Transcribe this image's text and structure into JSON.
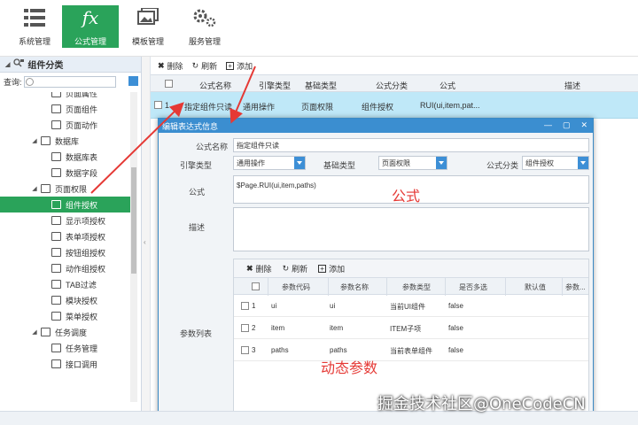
{
  "topbar": {
    "buttons": [
      {
        "label": "系统管理",
        "icon": "list-icon"
      },
      {
        "label": "公式管理",
        "icon": "fx-icon",
        "active": true
      },
      {
        "label": "模板管理",
        "icon": "images-icon"
      },
      {
        "label": "服务管理",
        "icon": "gears-icon"
      }
    ]
  },
  "left": {
    "header": "组件分类",
    "search_label": "查询:",
    "tree": [
      {
        "label": "页面属性",
        "level": 2
      },
      {
        "label": "页面组件",
        "level": 2
      },
      {
        "label": "页面动作",
        "level": 2
      },
      {
        "label": "数据库",
        "level": 1,
        "toggle": "◢"
      },
      {
        "label": "数据库表",
        "level": 2
      },
      {
        "label": "数据字段",
        "level": 2
      },
      {
        "label": "页面权限",
        "level": 1,
        "toggle": "◢"
      },
      {
        "label": "组件授权",
        "level": 2,
        "selected": true
      },
      {
        "label": "显示项授权",
        "level": 2
      },
      {
        "label": "表单项授权",
        "level": 2
      },
      {
        "label": "按钮组授权",
        "level": 2
      },
      {
        "label": "动作组授权",
        "level": 2
      },
      {
        "label": "TAB过滤",
        "level": 2
      },
      {
        "label": "模块授权",
        "level": 2
      },
      {
        "label": "菜单授权",
        "level": 2
      },
      {
        "label": "任务调度",
        "level": 1,
        "toggle": "◢"
      },
      {
        "label": "任务管理",
        "level": 2
      },
      {
        "label": "接口调用",
        "level": 2
      }
    ]
  },
  "main": {
    "toolbar": {
      "delete": "删除",
      "refresh": "刷新",
      "add": "添加"
    },
    "columns": [
      "公式名称",
      "引擎类型",
      "基础类型",
      "公式分类",
      "公式",
      "描述"
    ],
    "row": {
      "num": "1",
      "name": "指定组件只读",
      "engine": "通用操作",
      "base": "页面权限",
      "category": "组件授权",
      "formula": "RUI(ui,item,pat..."
    }
  },
  "dialog": {
    "title": "编辑表达式信息",
    "name_label": "公式名称",
    "name_value": "指定组件只读",
    "engine_label": "引擎类型",
    "engine_value": "通用操作",
    "base_label": "基础类型",
    "base_value": "页面权限",
    "category_label": "公式分类",
    "category_value": "组件授权",
    "formula_label": "公式",
    "formula_value": "$Page.RUI(ui,item,paths)",
    "desc_label": "描述",
    "params_label": "参数列表",
    "toolbar": {
      "delete": "删除",
      "refresh": "刷新",
      "add": "添加"
    },
    "param_columns": [
      "参数代码",
      "参数名称",
      "参数类型",
      "是否多选",
      "默认值",
      "参数..."
    ],
    "params": [
      {
        "num": "1",
        "code": "ui",
        "name": "ui",
        "type": "当前UI组件",
        "multi": "false"
      },
      {
        "num": "2",
        "code": "item",
        "name": "item",
        "type": "ITEM子项",
        "multi": "false"
      },
      {
        "num": "3",
        "code": "paths",
        "name": "paths",
        "type": "当前表单组件",
        "multi": "false"
      }
    ],
    "pager_label": "分页",
    "pager_page": "1"
  },
  "annotations": {
    "formula": "公式",
    "params": "动态参数"
  },
  "watermark": "掘金技术社区@OneCodeCN",
  "colors": {
    "accent_green": "#2aa35a",
    "dialog_blue": "#3b8ed0",
    "row_highlight": "#bfe8f8",
    "annotation_red": "#e53935"
  }
}
